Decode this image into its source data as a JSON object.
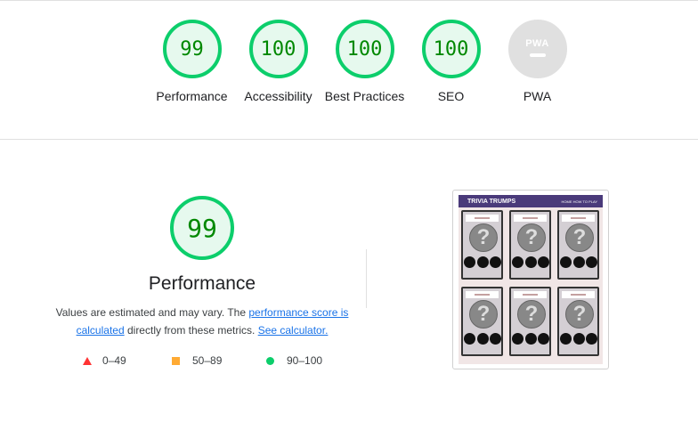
{
  "categories": [
    {
      "key": "performance",
      "score": "99",
      "label": "Performance"
    },
    {
      "key": "accessibility",
      "score": "100",
      "label": "Accessibility"
    },
    {
      "key": "best-practices",
      "score": "100",
      "label": "Best Practices"
    },
    {
      "key": "seo",
      "score": "100",
      "label": "SEO"
    },
    {
      "key": "pwa",
      "score": "PWA",
      "label": "PWA"
    }
  ],
  "performance": {
    "score": "99",
    "title": "Performance",
    "desc_prefix": "Values are estimated and may vary. The ",
    "link1": "performance score is calculated",
    "desc_middle": " directly from these metrics. ",
    "link2": "See calculator."
  },
  "legend": [
    {
      "range": "0–49",
      "color": "#ff3333"
    },
    {
      "range": "50–89",
      "color": "#ffaa33"
    },
    {
      "range": "90–100",
      "color": "#0cce6b"
    }
  ],
  "screenshot": {
    "title": "TRIVIA TRUMPS",
    "nav": "HOME   HOW TO PLAY",
    "card_glyph": "?"
  },
  "colors": {
    "pass": "#0cce6b",
    "pass_text": "#008800",
    "average": "#ffaa33",
    "fail": "#ff3333",
    "link": "#1a73e8",
    "pwa_gray": "#e0e0e0"
  }
}
